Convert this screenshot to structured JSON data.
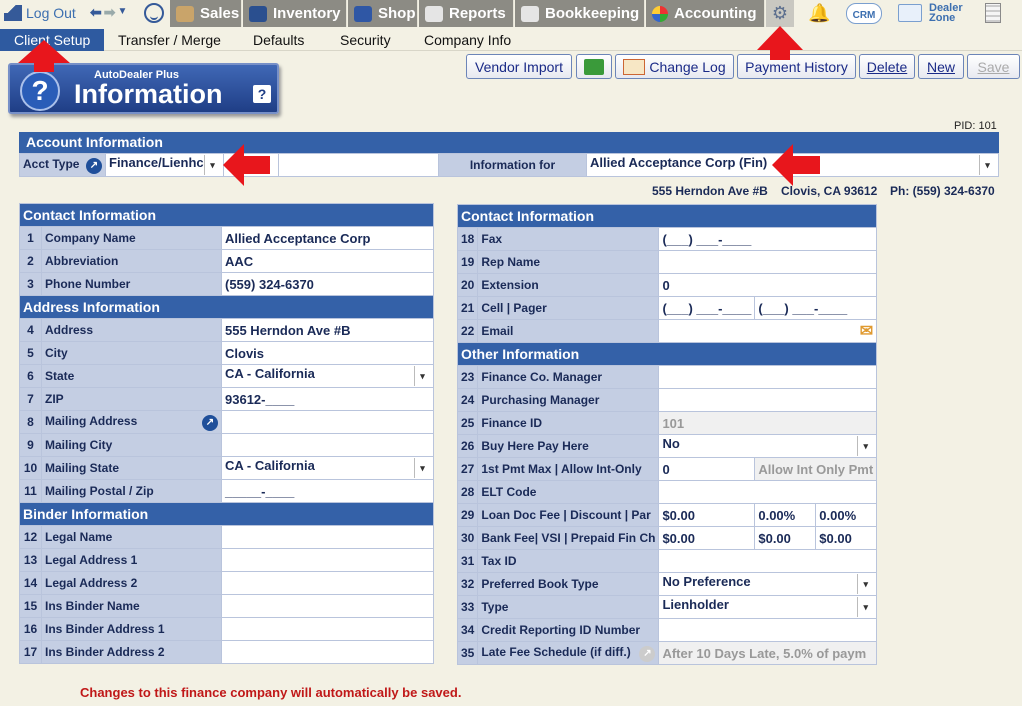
{
  "topnav": {
    "logout": "Log Out",
    "tabs": [
      "Sales",
      "Inventory",
      "Shop",
      "Reports",
      "Bookkeeping",
      "Accounting"
    ],
    "crm": "CRM",
    "dealer_zone": "Dealer Zone"
  },
  "subnav": [
    "Client Setup",
    "Transfer / Merge",
    "Defaults",
    "Security",
    "Company Info"
  ],
  "logo": {
    "small": "AutoDealer Plus",
    "big": "Information"
  },
  "toolbar": {
    "vendor_import": "Vendor Import",
    "change_log": "Change Log",
    "payment_history": "Payment History",
    "delete": "Delete",
    "new": "New",
    "save": "Save"
  },
  "pid": "PID: 101",
  "account": {
    "header": "Account Information",
    "acct_type_label": "Acct Type",
    "acct_type_value": "Finance/Lienhc",
    "info_for_label": "Information for",
    "info_for_value": "Allied Acceptance Corp (Fin)",
    "address": "555 Herndon Ave #B",
    "city_state": "Clovis, CA 93612",
    "phone": "Ph: (559) 324-6370"
  },
  "left": {
    "contact_header": "Contact Information",
    "contact_rows": [
      [
        "1",
        "Company Name",
        "Allied Acceptance Corp"
      ],
      [
        "2",
        "Abbreviation",
        "AAC"
      ],
      [
        "3",
        "Phone Number",
        "(559) 324-6370"
      ]
    ],
    "address_header": "Address Information",
    "address_rows": [
      [
        "4",
        "Address",
        "555 Herndon Ave #B"
      ],
      [
        "5",
        "City",
        "Clovis"
      ],
      [
        "6",
        "State",
        "CA - California"
      ],
      [
        "7",
        "ZIP",
        "93612-____"
      ],
      [
        "8",
        "Mailing Address",
        ""
      ],
      [
        "9",
        "Mailing City",
        ""
      ],
      [
        "10",
        "Mailing State",
        "CA - California"
      ],
      [
        "11",
        "Mailing Postal / Zip",
        "_____-____"
      ]
    ],
    "binder_header": "Binder Information",
    "binder_rows": [
      [
        "12",
        "Legal Name",
        ""
      ],
      [
        "13",
        "Legal Address 1",
        ""
      ],
      [
        "14",
        "Legal Address 2",
        ""
      ],
      [
        "15",
        "Ins Binder Name",
        ""
      ],
      [
        "16",
        "Ins Binder Address 1",
        ""
      ],
      [
        "17",
        "Ins Binder Address 2",
        ""
      ]
    ]
  },
  "right": {
    "contact_header": "Contact Information",
    "contact_rows": [
      [
        "18",
        "Fax",
        "(___) ___-____"
      ],
      [
        "19",
        "Rep Name",
        ""
      ],
      [
        "20",
        "Extension",
        "0"
      ],
      [
        "21",
        "Cell | Pager",
        "(___) ___-____",
        "(___) ___-____"
      ],
      [
        "22",
        "Email",
        ""
      ]
    ],
    "other_header": "Other Information",
    "other_rows": [
      [
        "23",
        "Finance Co. Manager",
        ""
      ],
      [
        "24",
        "Purchasing Manager",
        ""
      ],
      [
        "25",
        "Finance ID",
        "101"
      ],
      [
        "26",
        "Buy Here Pay Here",
        "No"
      ],
      [
        "27",
        "1st Pmt Max | Allow Int-Only",
        "0",
        "Allow Int Only Pmt"
      ],
      [
        "28",
        "ELT Code",
        ""
      ],
      [
        "29",
        "Loan Doc Fee | Discount | Par",
        "$0.00",
        "0.00%",
        "0.00%"
      ],
      [
        "30",
        "Bank Fee| VSI | Prepaid Fin Ch",
        "$0.00",
        "$0.00",
        "$0.00"
      ],
      [
        "31",
        "Tax ID",
        ""
      ],
      [
        "32",
        "Preferred Book Type",
        "No Preference"
      ],
      [
        "33",
        "Type",
        "Lienholder"
      ],
      [
        "34",
        "Credit Reporting ID Number",
        ""
      ],
      [
        "35",
        "Late Fee Schedule (if diff.)",
        "After 10 Days Late, 5.0% of paym"
      ]
    ]
  },
  "note": "Changes to this finance company will automatically be saved.",
  "colors": {
    "accent": "#3461a8",
    "label_bg": "#c4cee3",
    "arrow": "#e8161c"
  }
}
